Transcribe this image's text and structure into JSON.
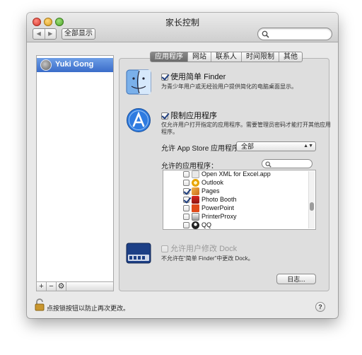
{
  "window": {
    "title": "家长控制"
  },
  "toolbar": {
    "back_label": "◀",
    "forward_label": "▶",
    "show_all_label": "全部显示",
    "search_placeholder": ""
  },
  "users": [
    {
      "name": "Yuki Gong"
    }
  ],
  "list_buttons": {
    "add": "+",
    "remove": "−",
    "action": "⚙"
  },
  "tabs": [
    {
      "label": "应用程序",
      "active": true
    },
    {
      "label": "网站",
      "active": false
    },
    {
      "label": "联系人",
      "active": false
    },
    {
      "label": "时间限制",
      "active": false
    },
    {
      "label": "其他",
      "active": false
    }
  ],
  "simple_finder": {
    "label": "使用简单 Finder",
    "checked": true,
    "description": "为青少年用户或无经验用户提供简化的电脑桌面显示。"
  },
  "limit_apps": {
    "label": "限制应用程序",
    "checked": true,
    "description_line1": "仅允许用户打开指定的应用程序。需要管理员密码才能打开其他应用",
    "description_line2": "程序。"
  },
  "app_store": {
    "label": "允许 App Store 应用程序：",
    "value": "全部"
  },
  "allowed_apps": {
    "label": "允许的应用程序：",
    "items": [
      {
        "name": "Open XML for Excel.app",
        "checked": false,
        "icon": "document-icon"
      },
      {
        "name": "Outlook",
        "checked": false,
        "icon": "outlook-icon"
      },
      {
        "name": "Pages",
        "checked": true,
        "icon": "pages-icon"
      },
      {
        "name": "Photo Booth",
        "checked": true,
        "icon": "photo-booth-icon"
      },
      {
        "name": "PowerPoint",
        "checked": false,
        "icon": "powerpoint-icon"
      },
      {
        "name": "PrinterProxy",
        "checked": false,
        "icon": "printer-icon"
      },
      {
        "name": "QQ",
        "checked": false,
        "icon": "qq-penguin-icon"
      }
    ]
  },
  "dock": {
    "label": "允许用户修改 Dock",
    "checked": false,
    "description": "不允许在“简单 Finder”中更改 Dock。"
  },
  "log_button": "日志...",
  "help_label": "?",
  "lock": {
    "text": "点按锁按钮以防止再次更改。"
  },
  "colors": {
    "selection": "#3a6cc9",
    "tab_active": "#6a6a6a"
  }
}
